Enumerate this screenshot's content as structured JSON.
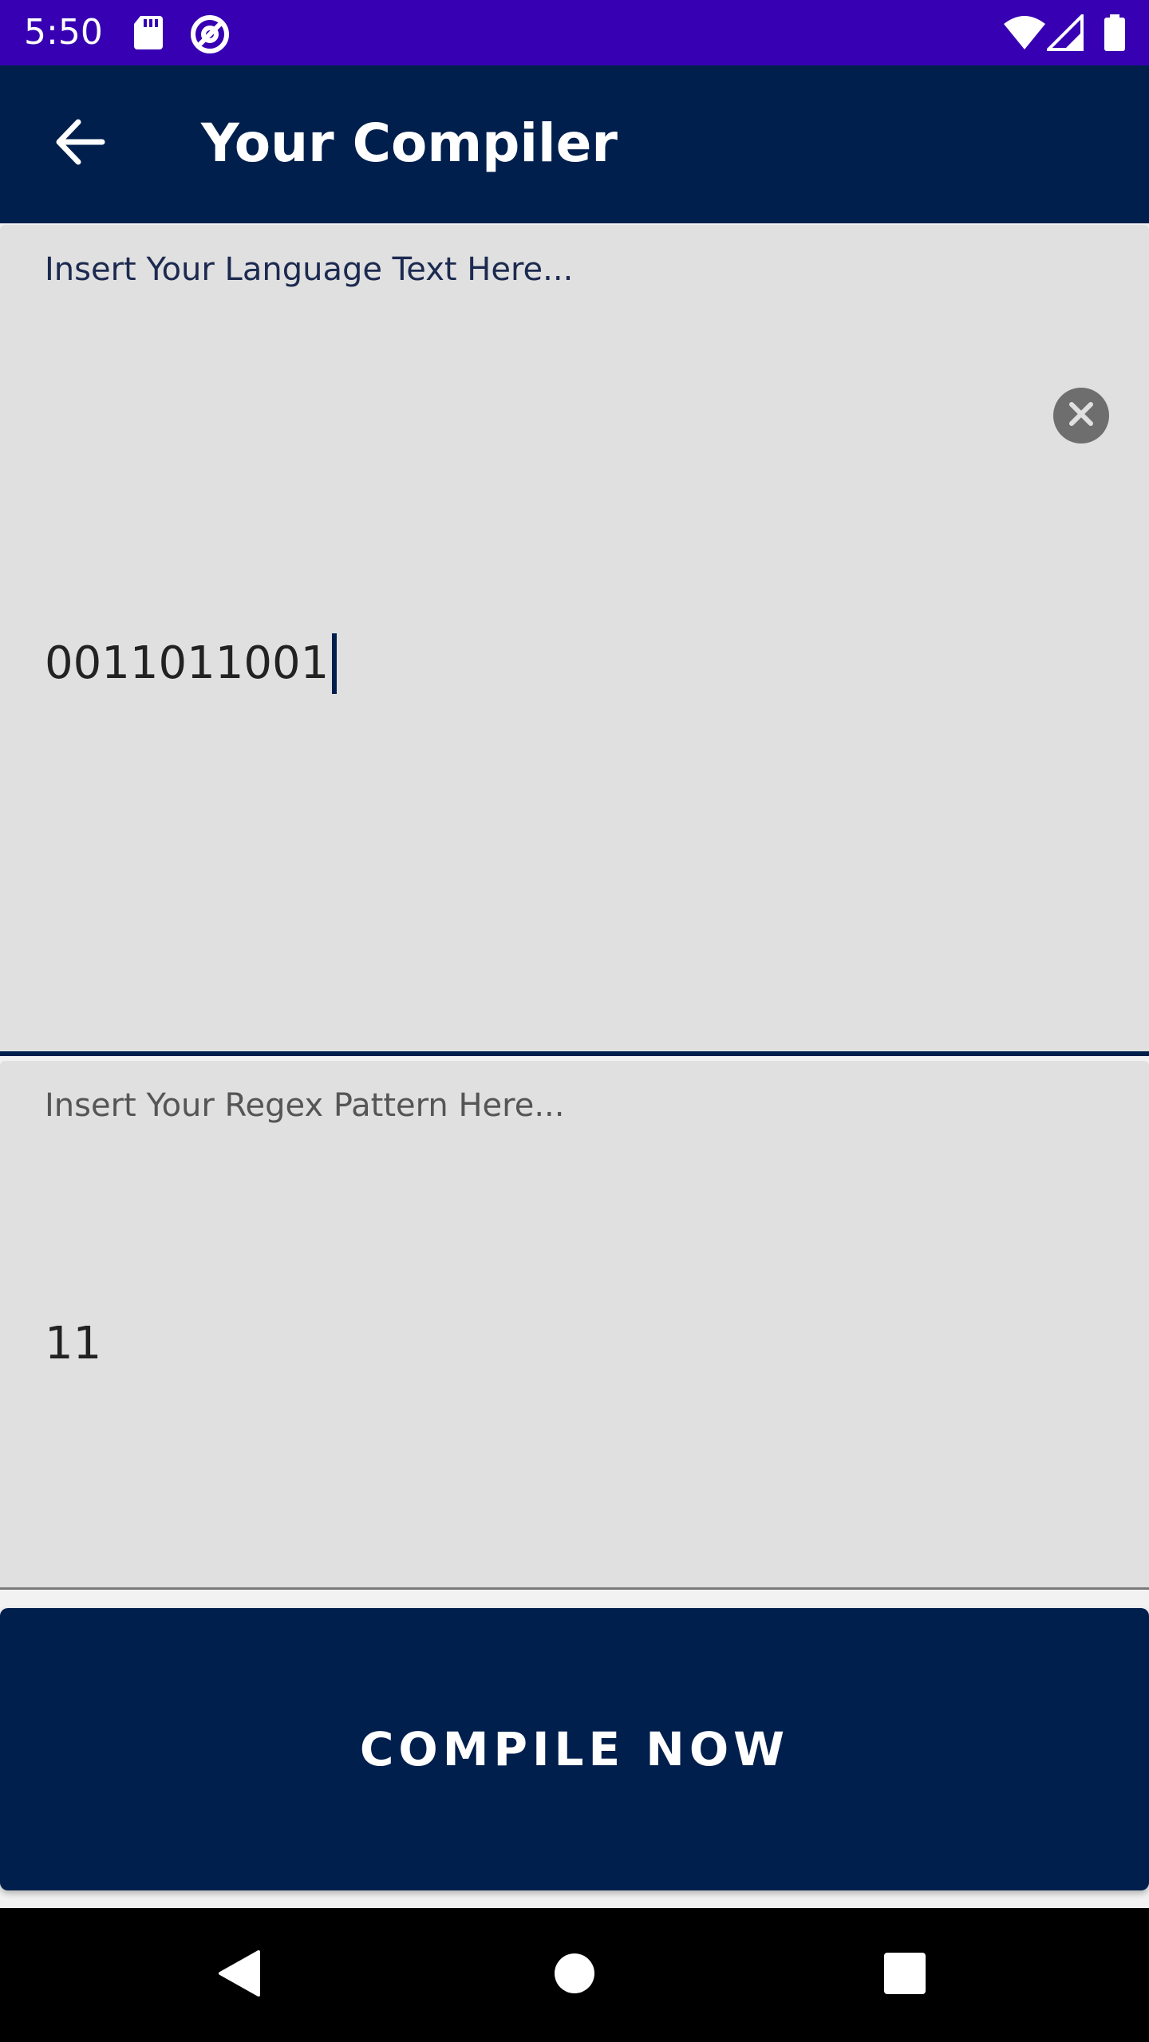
{
  "status_bar": {
    "time": "5:50",
    "left_icons": [
      "sd-card-icon",
      "at-sign-icon"
    ],
    "right_icons": [
      "wifi-icon",
      "cellular-signal-icon",
      "battery-icon"
    ]
  },
  "app_bar": {
    "back_icon": "arrow-left-icon",
    "title": "Your Compiler"
  },
  "language_field": {
    "hint": "Insert Your Language Text Here...",
    "value": "0011011001",
    "clear_icon": "close-circle-icon"
  },
  "regex_field": {
    "hint": "Insert Your Regex Pattern Here...",
    "value": "11"
  },
  "compile_button": {
    "label": "COMPILE NOW"
  },
  "nav_bar": {
    "icons": [
      "back-triangle-icon",
      "home-circle-icon",
      "recents-square-icon"
    ]
  },
  "colors": {
    "status_bar": "#3700b3",
    "primary": "#001f4d",
    "field_background": "#e0e0e0",
    "nav_bar": "#000000"
  }
}
